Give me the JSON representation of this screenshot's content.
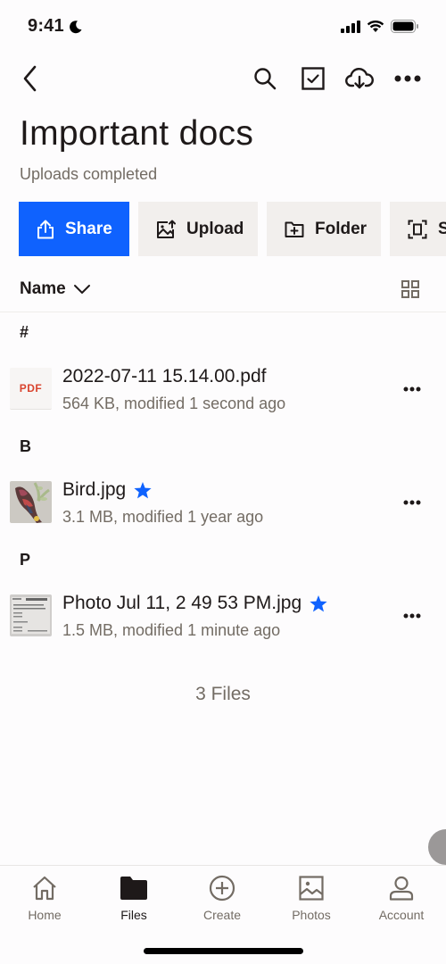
{
  "status_bar": {
    "time": "9:41",
    "icons": [
      "moon-icon",
      "signal-icon",
      "wifi-icon",
      "battery-icon"
    ]
  },
  "nav": {
    "back_icon": "chevron-left-icon",
    "actions": [
      "search-icon",
      "select-checkbox-icon",
      "cloud-download-icon",
      "more-horizontal-icon"
    ]
  },
  "header": {
    "title": "Important docs",
    "subtitle": "Uploads completed"
  },
  "actions": [
    {
      "label": "Share",
      "icon": "share-upload-icon",
      "primary": true,
      "color": "#0f62fe"
    },
    {
      "label": "Upload",
      "icon": "image-upload-icon",
      "primary": false
    },
    {
      "label": "Folder",
      "icon": "folder-plus-icon",
      "primary": false
    },
    {
      "label": "Scan",
      "icon": "scan-icon",
      "primary": false
    }
  ],
  "sort": {
    "label": "Name",
    "view_toggle_icon": "grid-view-icon"
  },
  "sections": [
    {
      "header": "#",
      "files": [
        {
          "name": "2022-07-11 15.14.00.pdf",
          "meta": "564 KB, modified 1 second ago",
          "thumb": "PDF",
          "starred": false
        }
      ]
    },
    {
      "header": "B",
      "files": [
        {
          "name": "Bird.jpg",
          "meta": "3.1 MB, modified 1 year ago",
          "thumb": "bird-image",
          "starred": true
        }
      ]
    },
    {
      "header": "P",
      "files": [
        {
          "name": "Photo Jul 11, 2 49 53 PM.jpg",
          "meta": "1.5 MB, modified 1 minute ago",
          "thumb": "receipt-photo",
          "starred": true
        }
      ]
    }
  ],
  "file_count": "3 Files",
  "colors": {
    "accent": "#0f62fe",
    "star": "#0f62fe",
    "pdf_label": "#d9442e",
    "text_primary": "#1e1919",
    "text_secondary": "#736c64"
  },
  "tab_bar": {
    "tabs": [
      {
        "label": "Home",
        "icon": "home-icon",
        "active": false
      },
      {
        "label": "Files",
        "icon": "folder-icon",
        "active": true
      },
      {
        "label": "Create",
        "icon": "plus-circle-icon",
        "active": false
      },
      {
        "label": "Photos",
        "icon": "photo-icon",
        "active": false
      },
      {
        "label": "Account",
        "icon": "person-icon",
        "active": false
      }
    ]
  }
}
